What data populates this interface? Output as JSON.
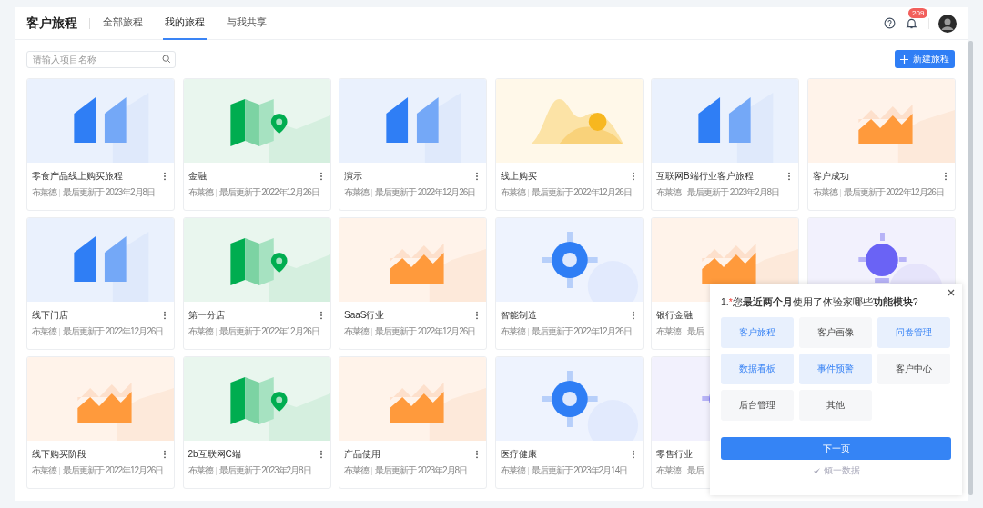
{
  "header": {
    "title": "客户旅程",
    "tabs": [
      {
        "label": "全部旅程",
        "selected": false
      },
      {
        "label": "我的旅程",
        "selected": true
      },
      {
        "label": "与我共享",
        "selected": false
      }
    ],
    "notification_count": "209"
  },
  "search": {
    "placeholder": "请输入项目名称"
  },
  "new_button": {
    "label": "新建旅程"
  },
  "cards": [
    {
      "kind": "bars",
      "title": "零食产品线上购买旅程",
      "author": "布莱德",
      "updated": "最后更新于 2023年2月8日"
    },
    {
      "kind": "map",
      "title": "金融",
      "author": "布莱德",
      "updated": "最后更新于 2022年12月26日"
    },
    {
      "kind": "bars",
      "title": "演示",
      "author": "布莱德",
      "updated": "最后更新于 2022年12月26日"
    },
    {
      "kind": "hill",
      "title": "线上购买",
      "author": "布莱德",
      "updated": "最后更新于 2022年12月26日"
    },
    {
      "kind": "bars",
      "title": "互联网B端行业客户旅程",
      "author": "布莱德",
      "updated": "最后更新于 2023年2月8日"
    },
    {
      "kind": "chart",
      "title": "客户成功",
      "author": "布莱德",
      "updated": "最后更新于 2022年12月26日"
    },
    {
      "kind": "bars",
      "title": "线下门店",
      "author": "布莱德",
      "updated": "最后更新于 2022年12月26日"
    },
    {
      "kind": "map",
      "title": "第一分店",
      "author": "布莱德",
      "updated": "最后更新于 2022年12月26日"
    },
    {
      "kind": "chart",
      "title": "SaaS行业",
      "author": "布莱德",
      "updated": "最后更新于 2022年12月26日"
    },
    {
      "kind": "target",
      "title": "智能制造",
      "author": "布莱德",
      "updated": "最后更新于 2022年12月26日"
    },
    {
      "kind": "chart",
      "title": "银行金融",
      "author": "布莱德",
      "updated": "最后"
    },
    {
      "kind": "bulb"
    },
    {
      "kind": "chart",
      "title": "线下购买阶段",
      "author": "布莱德",
      "updated": "最后更新于 2022年12月26日"
    },
    {
      "kind": "map",
      "title": "2b互联网C端",
      "author": "布莱德",
      "updated": "最后更新于 2023年2月8日"
    },
    {
      "kind": "chart",
      "title": "产品使用",
      "author": "布莱德",
      "updated": "最后更新于 2023年2月8日"
    },
    {
      "kind": "target",
      "title": "医疗健康",
      "author": "布莱德",
      "updated": "最后更新于 2023年2月14日"
    },
    {
      "kind": "bulb",
      "title": "零售行业",
      "author": "布莱德",
      "updated": "最后"
    }
  ],
  "survey": {
    "number": "1.",
    "required_mark": "*",
    "question": "您**最近两个月**使用了体验家哪些**功能模块**?",
    "options": [
      {
        "label": "客户旅程",
        "selected": true
      },
      {
        "label": "客户画像",
        "selected": false
      },
      {
        "label": "问卷管理",
        "selected": true
      },
      {
        "label": "数据看板",
        "selected": true
      },
      {
        "label": "事件预警",
        "selected": true
      },
      {
        "label": "客户中心",
        "selected": false
      },
      {
        "label": "后台管理",
        "selected": false
      },
      {
        "label": "其他",
        "selected": false
      }
    ],
    "next_button": "下一页",
    "footer": "倾一数据"
  }
}
